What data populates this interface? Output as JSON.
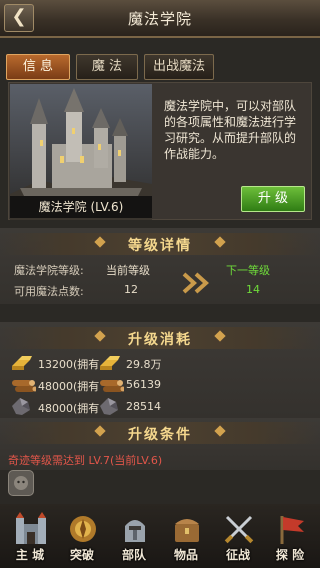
{
  "header": {
    "title": "魔法学院",
    "back_icon": "back-arrow-icon"
  },
  "tabs": [
    {
      "label": "信 息",
      "active": true
    },
    {
      "label": "魔 法",
      "active": false
    },
    {
      "label": "出战魔法",
      "active": false
    }
  ],
  "info": {
    "building_name": "魔法学院 (LV.6)",
    "description": "魔法学院中，可以对部队的各项属性和魔法进行学习研究。从而提升部队的作战能力。",
    "upgrade_label": "升 级"
  },
  "level_details": {
    "title": "等级详情",
    "row1_label": "魔法学院等级:",
    "current_label": "当前等级",
    "next_label": "下一等级",
    "row2_label": "可用魔法点数:",
    "current_points": "12",
    "next_points": "14"
  },
  "cost": {
    "title": "升级消耗",
    "items": [
      {
        "icon": "gold-bars-icon",
        "required": "13200(拥有",
        "owned": "29.8万",
        "owned_color": "#6fdc3a"
      },
      {
        "icon": "wood-logs-icon",
        "required": "48000(拥有",
        "owned": "56139",
        "owned_color": "#6fdc3a"
      },
      {
        "icon": "ore-stone-icon",
        "required": "48000(拥有",
        "owned": "28514",
        "owned_color": "#e0574a"
      }
    ]
  },
  "conditions": {
    "title": "升级条件",
    "text": "奇迹等级需达到 LV.7(当前LV.6)"
  },
  "bottom_nav": [
    {
      "label": "主 城",
      "icon": "castle-icon"
    },
    {
      "label": "突破",
      "icon": "breakthrough-icon"
    },
    {
      "label": "部队",
      "icon": "troops-icon"
    },
    {
      "label": "物品",
      "icon": "items-icon"
    },
    {
      "label": "征战",
      "icon": "crossed-swords-icon"
    },
    {
      "label": "探 险",
      "icon": "explore-flag-icon"
    }
  ],
  "colors": {
    "accent_green": "#6fdc3a",
    "warning_red": "#e0574a",
    "active_tab": "#b96a2e",
    "section_title": "#f5d88e"
  }
}
